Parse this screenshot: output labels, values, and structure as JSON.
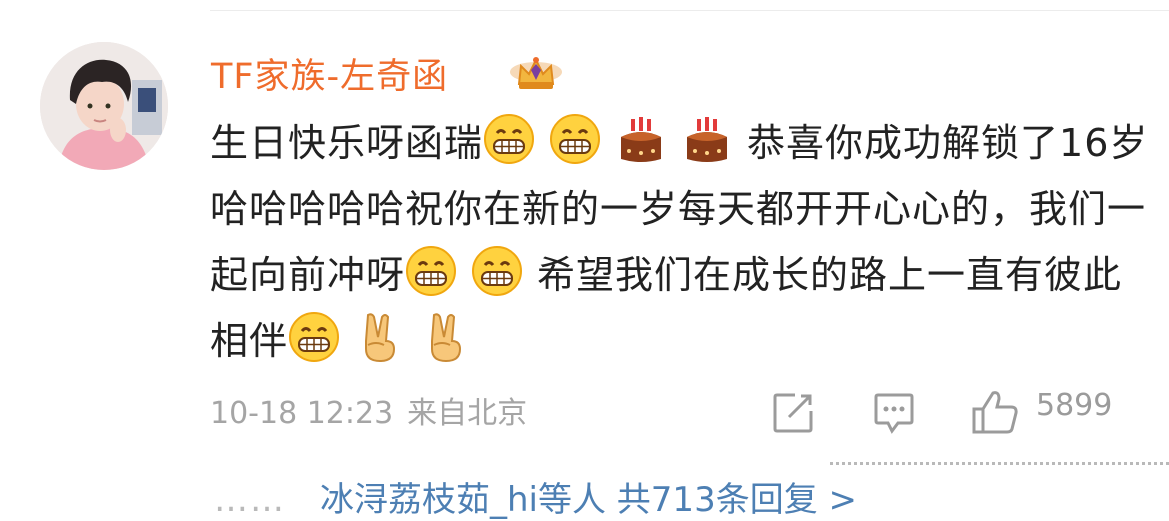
{
  "comment": {
    "username": "TF家族-左奇函",
    "content_parts": [
      {
        "type": "text",
        "value": "生日快乐呀函瑞"
      },
      {
        "type": "emoji",
        "icon": "grin-emoji-icon"
      },
      {
        "type": "emoji",
        "icon": "grin-emoji-icon"
      },
      {
        "type": "emoji",
        "icon": "cake-emoji-icon"
      },
      {
        "type": "emoji",
        "icon": "cake-emoji-icon"
      },
      {
        "type": "text",
        "value": "恭喜你成功解锁了16岁哈哈哈哈哈祝你在新的一岁每天都开开心心的，我们一起向前冲呀"
      },
      {
        "type": "emoji",
        "icon": "grin-emoji-icon"
      },
      {
        "type": "emoji",
        "icon": "grin-emoji-icon"
      },
      {
        "type": "text",
        "value": "希望我们在成长的路上一直有彼此相伴"
      },
      {
        "type": "emoji",
        "icon": "grin-emoji-icon"
      },
      {
        "type": "emoji",
        "icon": "victory-hand-emoji-icon"
      },
      {
        "type": "emoji",
        "icon": "victory-hand-emoji-icon"
      }
    ],
    "timestamp": "10-18 12:23",
    "location": "来自北京",
    "like_count": "5899",
    "replies_text": "冰浔荔枝茹_hi等人 共713条回复 >",
    "replies_dots": "……",
    "colors": {
      "username": "#ef6c2c",
      "link": "#4d7fb3",
      "meta": "#a5a5a5"
    }
  }
}
